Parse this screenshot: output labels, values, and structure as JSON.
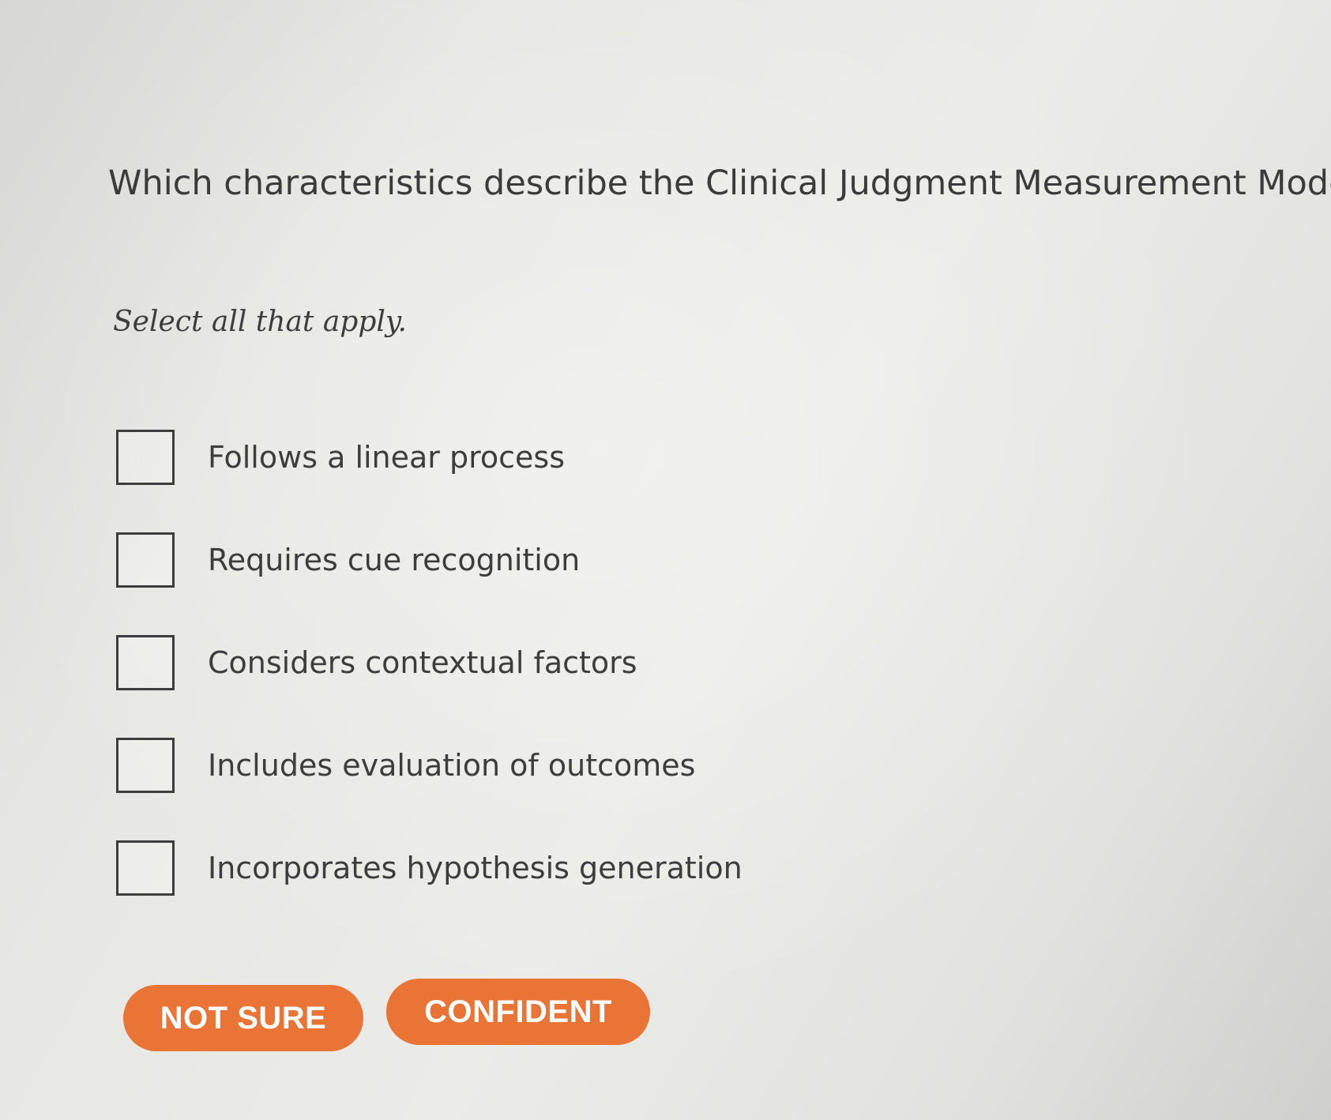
{
  "question": {
    "text": "Which characteristics describe the Clinical Judgment Measurement Model (CJMM"
  },
  "instruction": {
    "text": "Select all that apply."
  },
  "options": [
    {
      "label": "Follows a linear process",
      "checked": false
    },
    {
      "label": "Requires cue recognition",
      "checked": false
    },
    {
      "label": "Considers contextual factors",
      "checked": false
    },
    {
      "label": "Includes evaluation of outcomes",
      "checked": false
    },
    {
      "label": "Incorporates hypothesis generation",
      "checked": false
    }
  ],
  "buttons": {
    "not_sure": "NOT SURE",
    "confident": "CONFIDENT"
  },
  "colors": {
    "accent": "#e97435",
    "text": "#3d3d3d",
    "background": "#e6e6e3"
  }
}
